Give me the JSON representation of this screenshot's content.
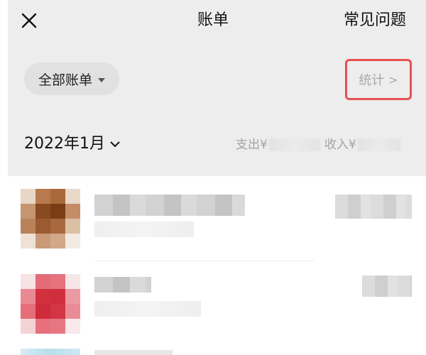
{
  "header": {
    "title": "账单",
    "faq_label": "常见问题",
    "close_icon": "close-icon"
  },
  "filter": {
    "label": "全部账单",
    "icon": "caret-down-icon"
  },
  "stats": {
    "label": "统计",
    "chevron": ">",
    "highlight_color": "#e8504f"
  },
  "summary": {
    "month": "2022年1月",
    "expense_label": "支出¥",
    "income_label": "收入¥"
  },
  "transactions": [
    {
      "avatar_palette": [
        "#e7d7c6",
        "#b77a4e",
        "#a9693b",
        "#e8d9c9",
        "#c59470",
        "#8a4a21",
        "#7a3d15",
        "#c38d66",
        "#b98258",
        "#9c5a30",
        "#a8693f",
        "#dcc0a4",
        "#eee2d6",
        "#c99a77",
        "#d2a888",
        "#f3ebe3"
      ]
    },
    {
      "avatar_palette": [
        "#f6e3e4",
        "#e36b77",
        "#e4737e",
        "#f7e6e7",
        "#e98a93",
        "#d3303f",
        "#d12e3d",
        "#ec9aa2",
        "#e56e79",
        "#cf2c3b",
        "#d43544",
        "#ea8c95",
        "#f4d3d6",
        "#e7707b",
        "#e57682",
        "#f8e9ea"
      ]
    }
  ],
  "colors": {
    "header_bg": "#ededed",
    "muted_text": "#a3a3a3"
  }
}
